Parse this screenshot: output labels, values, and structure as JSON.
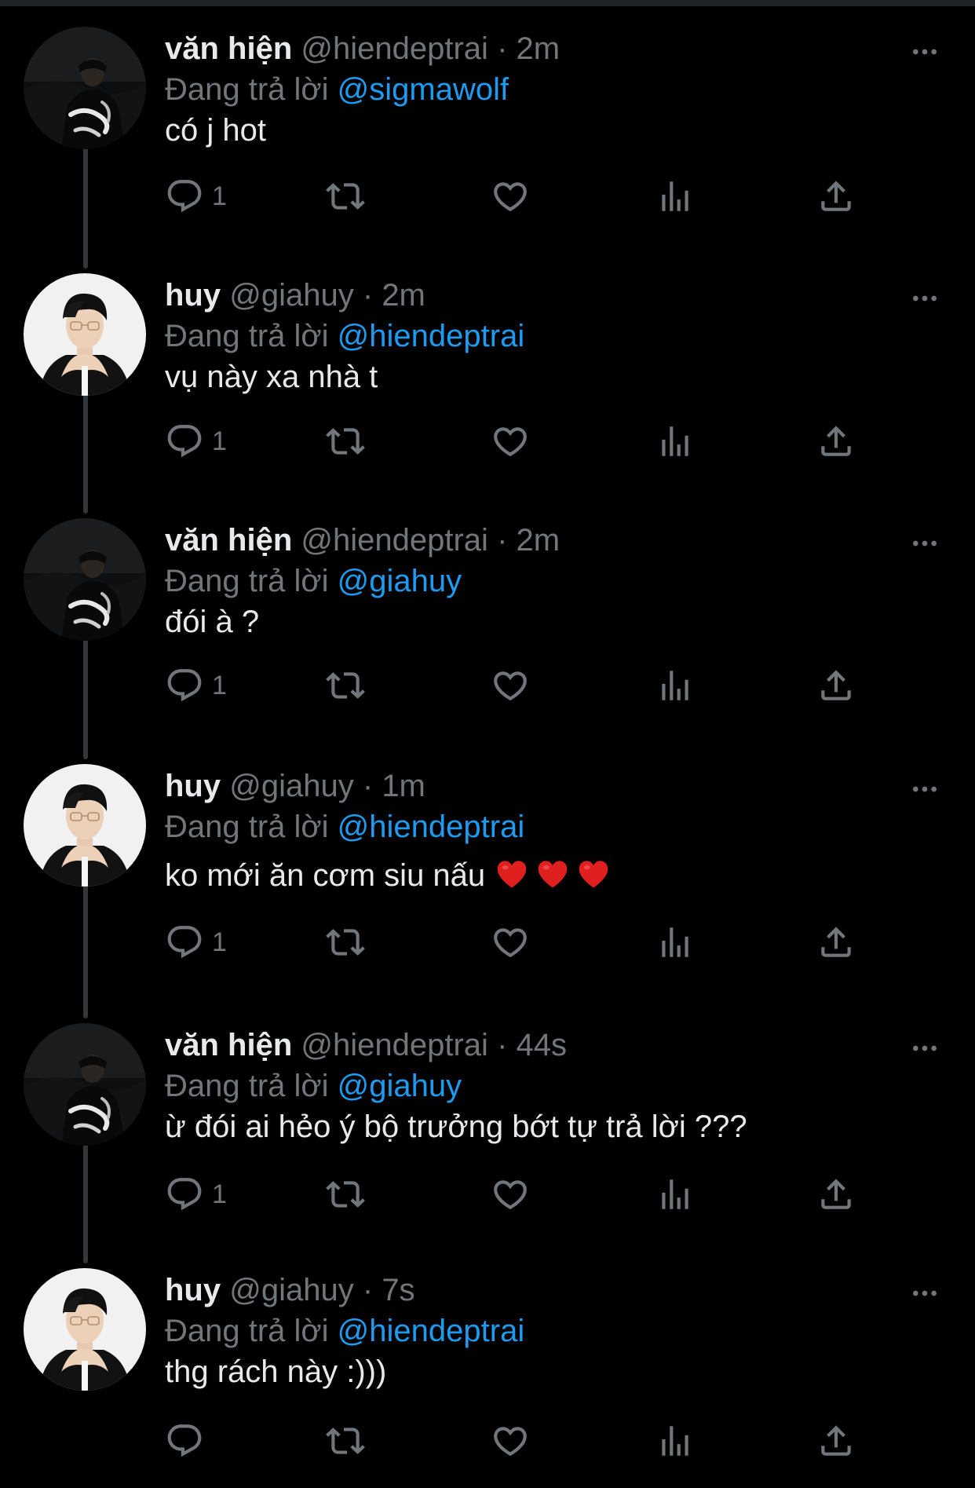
{
  "colors": {
    "background": "#000000",
    "text": "#e7e9ea",
    "muted": "#71767b",
    "accent": "#1d9bf0",
    "thread_line": "#333639"
  },
  "reply_prefix": "Đang trả lời",
  "icons": {
    "more": "more-dots-icon",
    "reply": "reply-icon",
    "retweet": "retweet-icon",
    "like": "heart-icon",
    "views": "views-icon",
    "share": "share-icon"
  },
  "tweets": [
    {
      "name": "văn hiện",
      "handle": "@hiendeptrai",
      "dot": "·",
      "time": "2m",
      "reply_to": "@sigmawolf",
      "text": "có j hot",
      "reply_count": "1",
      "avatar": "avatar-hien"
    },
    {
      "name": "huy",
      "handle": "@giahuy",
      "dot": "·",
      "time": "2m",
      "reply_to": "@hiendeptrai",
      "text": "vụ này xa nhà t",
      "reply_count": "1",
      "avatar": "avatar-huy"
    },
    {
      "name": "văn hiện",
      "handle": "@hiendeptrai",
      "dot": "·",
      "time": "2m",
      "reply_to": "@giahuy",
      "text": "đói à ?",
      "reply_count": "1",
      "avatar": "avatar-hien"
    },
    {
      "name": "huy",
      "handle": "@giahuy",
      "dot": "·",
      "time": "1m",
      "reply_to": "@hiendeptrai",
      "text": "ko mới ăn cơm siu nấu",
      "emoji": [
        "red-heart-emoji",
        "red-heart-emoji",
        "red-heart-emoji"
      ],
      "reply_count": "1",
      "avatar": "avatar-huy"
    },
    {
      "name": "văn hiện",
      "handle": "@hiendeptrai",
      "dot": "·",
      "time": "44s",
      "reply_to": "@giahuy",
      "text": "ừ đói ai hẻo ý bộ trưởng bớt tự trả lời ???",
      "reply_count": "1",
      "avatar": "avatar-hien"
    },
    {
      "name": "huy",
      "handle": "@giahuy",
      "dot": "·",
      "time": "7s",
      "reply_to": "@hiendeptrai",
      "text": "thg rách này :)))",
      "reply_count": "",
      "avatar": "avatar-huy"
    }
  ]
}
